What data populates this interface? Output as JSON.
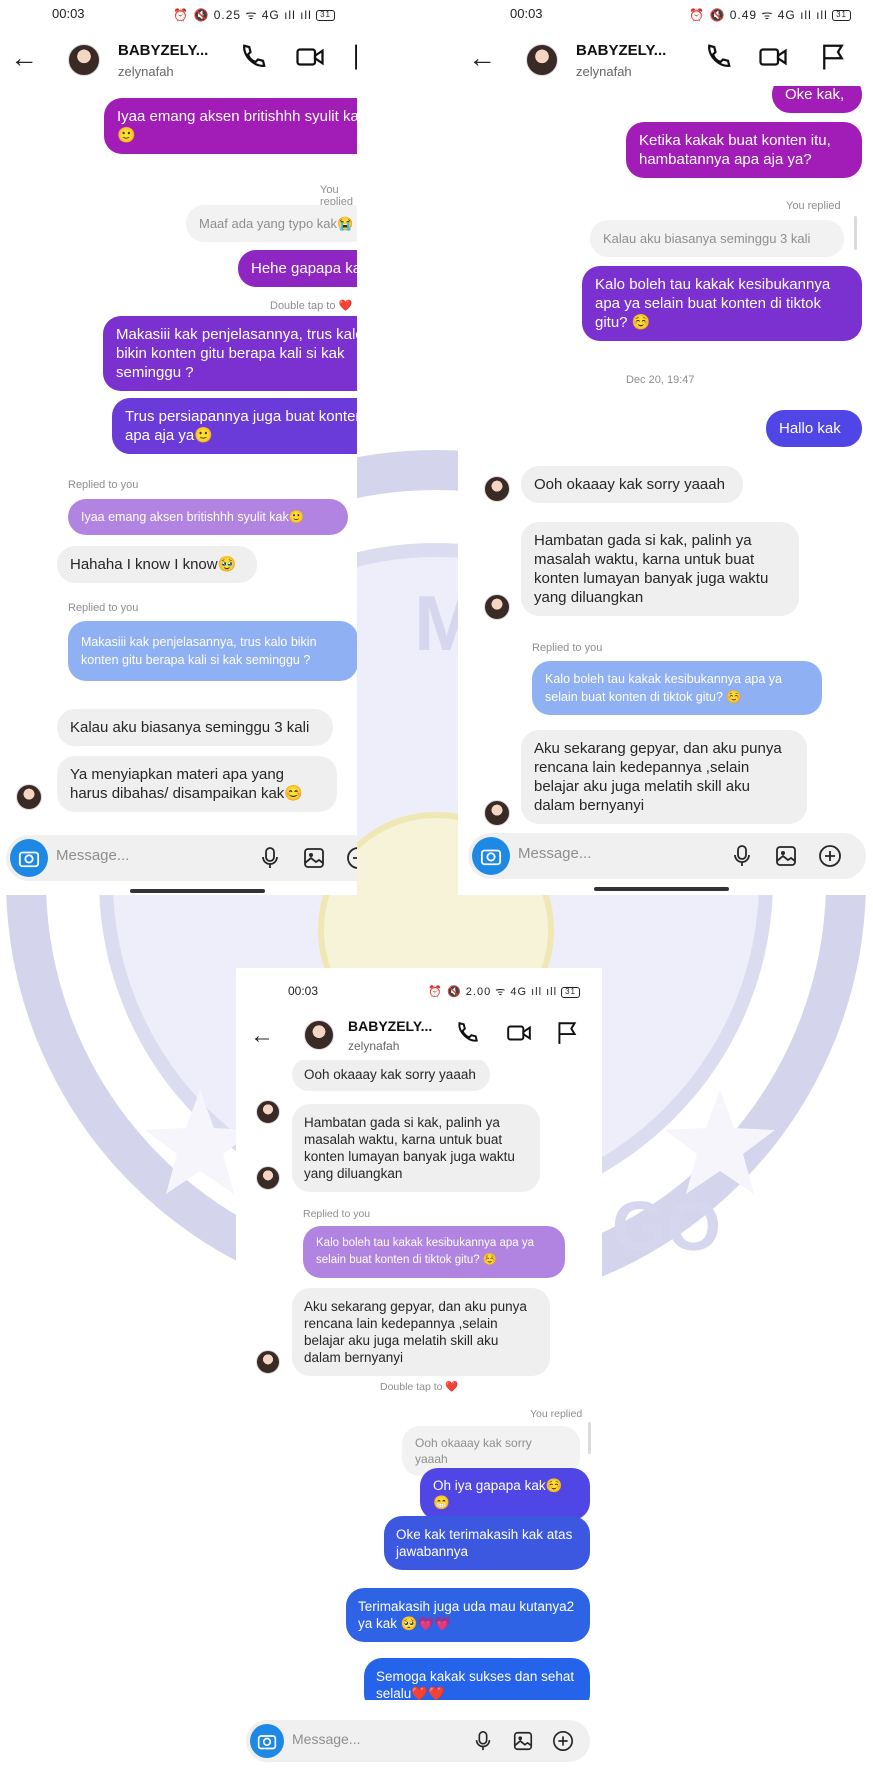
{
  "conversation": {
    "name": "BABYZELY...",
    "username": "zelynafah",
    "composer_placeholder": "Message..."
  },
  "watermark": {
    "text_left": "M",
    "text_right": "GO"
  },
  "screen1": {
    "time": "00:03",
    "status": "⏰ 🔇 0.25 ᯤ 4G ıll ıll",
    "battery": "31",
    "msgs": [
      "Iyaa emang aksen britishhh syulit kak 🙂",
      "You replied",
      "Maaf ada yang typo kak😭",
      "Hehe gapapa kak,",
      "Double tap to ❤️",
      "Makasiii kak penjelasannya, trus kalo bikin konten gitu berapa kali si kak seminggu ?",
      "Trus persiapannya juga buat konten apa aja ya🙂",
      "Replied to you",
      "Iyaa emang aksen britishhh syulit kak🙂",
      "Hahaha I know I know🥹",
      "Replied to you",
      "Makasiii kak penjelasannya, trus kalo bikin konten gitu berapa kali si kak seminggu ?",
      "Kalau aku biasanya seminggu 3 kali",
      "Ya menyiapkan materi apa yang harus dibahas/ disampaikan kak😊"
    ]
  },
  "screen2": {
    "time": "00:03",
    "status": "⏰ 🔇 0.49 ᯤ 4G ıll ıll",
    "battery": "31",
    "msgs": [
      "Oke kak,",
      "Ketika kakak buat konten itu, hambatannya apa aja ya?",
      "You replied",
      "Kalau aku biasanya seminggu 3 kali",
      "Kalo boleh tau kakak kesibukannya apa ya selain buat konten di tiktok gitu? ☺️",
      "Dec 20, 19:47",
      "Hallo kak",
      "Ooh okaaay kak sorry yaaah",
      "Hambatan gada si kak, palinh ya masalah waktu, karna untuk buat konten lumayan banyak juga waktu yang diluangkan",
      "Replied to you",
      "Kalo boleh tau kakak kesibukannya apa ya selain buat konten di tiktok gitu? ☺️",
      "Aku sekarang gepyar, dan aku punya rencana lain kedepannya ,selain belajar aku juga melatih skill aku dalam bernyanyi"
    ]
  },
  "screen3": {
    "time": "00:03",
    "status": "⏰ 🔇 2.00 ᯤ 4G ıll ıll",
    "battery": "31",
    "msgs": [
      "Ooh okaaay kak sorry yaaah",
      "Hambatan gada si kak, palinh ya masalah waktu, karna untuk buat konten lumayan banyak juga waktu yang diluangkan",
      "Replied to you",
      "Kalo boleh tau kakak kesibukannya apa ya selain buat konten di tiktok gitu? ☺️",
      "Aku sekarang gepyar, dan aku punya rencana lain kedepannya ,selain belajar aku juga melatih skill aku dalam bernyanyi",
      "Double tap to ❤️",
      "You replied",
      "Ooh okaaay kak sorry yaaah",
      "Oh iya gapapa kak☺️😁",
      "Oke kak terimakasih kak atas jawabannya",
      "Terimakasih juga uda mau kutanya2 ya kak 🥺💗💗",
      "Semoga kakak sukses dan sehat selalu❤️❤️"
    ]
  },
  "colors": {
    "magenta": "#a21cb7",
    "purple": "#6a3bd8",
    "indigo": "#4f46e5",
    "blue": "#2563eb",
    "reply_purple": "#b084e0",
    "reply_blue": "#8fb0f2",
    "camera": "#1e88e5"
  }
}
